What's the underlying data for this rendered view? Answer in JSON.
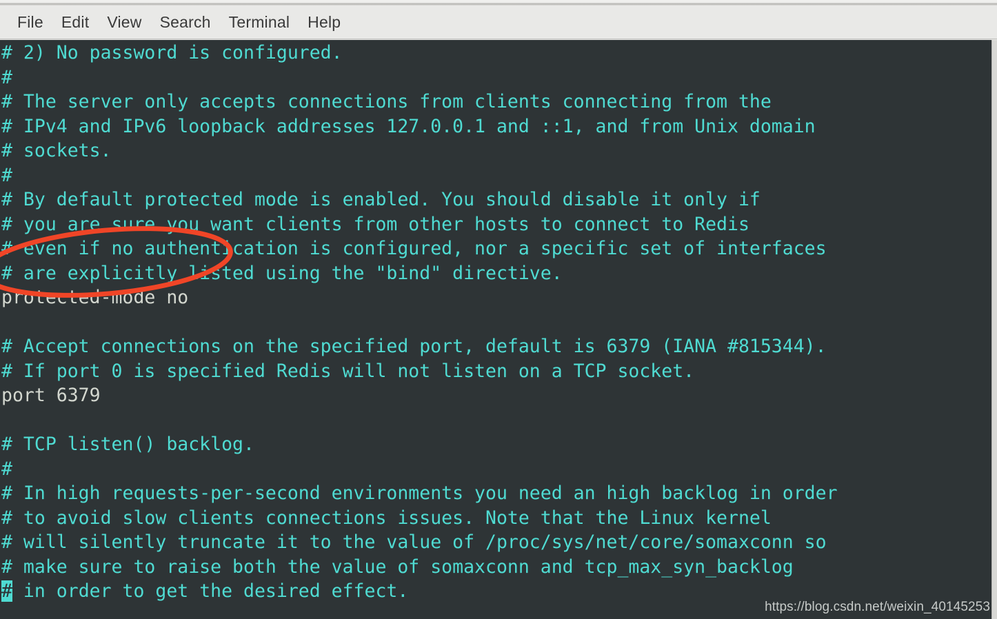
{
  "window": {
    "app": "Terminal",
    "menu": [
      "File",
      "Edit",
      "View",
      "Search",
      "Terminal",
      "Help"
    ]
  },
  "colors": {
    "terminal_background": "#2e3436",
    "comment_text": "#4fdbd2",
    "command_text": "#d3d7cf",
    "annotation_red": "#f04527",
    "menubar_background": "#e9e9e7",
    "menubar_text": "#3a3a3a",
    "watermark_text": "#c6cac8"
  },
  "terminal": {
    "lines": [
      {
        "text": "# 2) No password is configured.",
        "kind": "comment"
      },
      {
        "text": "#",
        "kind": "comment"
      },
      {
        "text": "# The server only accepts connections from clients connecting from the",
        "kind": "comment"
      },
      {
        "text": "# IPv4 and IPv6 loopback addresses 127.0.0.1 and ::1, and from Unix domain",
        "kind": "comment"
      },
      {
        "text": "# sockets.",
        "kind": "comment"
      },
      {
        "text": "#",
        "kind": "comment"
      },
      {
        "text": "# By default protected mode is enabled. You should disable it only if",
        "kind": "comment"
      },
      {
        "text": "# you are sure you want clients from other hosts to connect to Redis",
        "kind": "comment"
      },
      {
        "text": "# even if no authentication is configured, nor a specific set of interfaces",
        "kind": "comment"
      },
      {
        "text": "# are explicitly listed using the \"bind\" directive.",
        "kind": "comment"
      },
      {
        "text": "protected-mode no",
        "kind": "command"
      },
      {
        "text": "",
        "kind": "blank"
      },
      {
        "text": "# Accept connections on the specified port, default is 6379 (IANA #815344).",
        "kind": "comment"
      },
      {
        "text": "# If port 0 is specified Redis will not listen on a TCP socket.",
        "kind": "comment"
      },
      {
        "text": "port 6379",
        "kind": "command"
      },
      {
        "text": "",
        "kind": "blank"
      },
      {
        "text": "# TCP listen() backlog.",
        "kind": "comment"
      },
      {
        "text": "#",
        "kind": "comment"
      },
      {
        "text": "# In high requests-per-second environments you need an high backlog in order",
        "kind": "comment"
      },
      {
        "text": "# to avoid slow clients connections issues. Note that the Linux kernel",
        "kind": "comment"
      },
      {
        "text": "# will silently truncate it to the value of /proc/sys/net/core/somaxconn so",
        "kind": "comment"
      },
      {
        "text": "# make sure to raise both the value of somaxconn and tcp_max_syn_backlog",
        "kind": "comment"
      },
      {
        "text": "# in order to get the desired effect.",
        "kind": "comment",
        "cursor": true
      }
    ]
  },
  "annotation": {
    "shape": "ellipse",
    "target_text": "protected-mode no",
    "color": "#f04527"
  },
  "watermark": {
    "text": "https://blog.csdn.net/weixin_40145253"
  }
}
